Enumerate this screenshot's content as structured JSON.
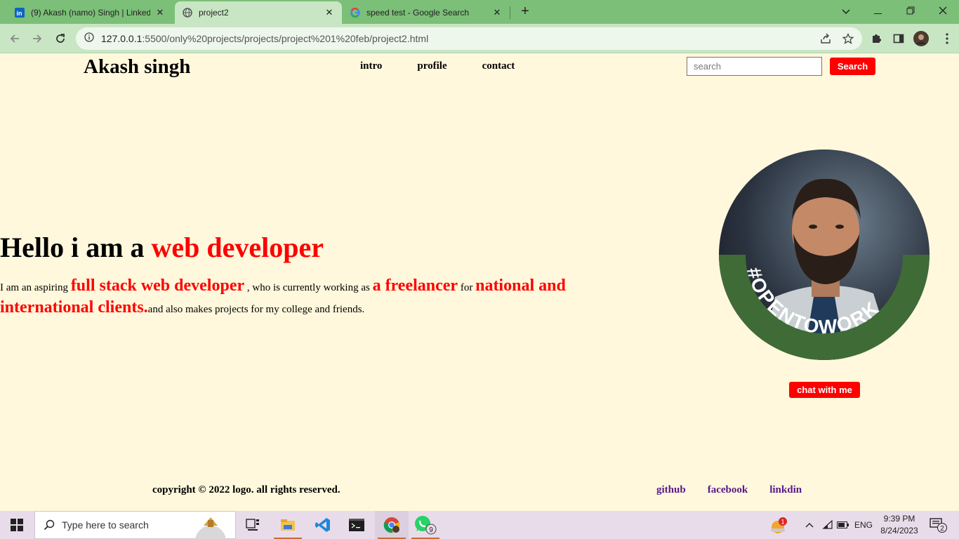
{
  "browser": {
    "tabs": [
      {
        "title": "(9) Akash (namo) Singh | LinkedIn",
        "icon": "linkedin-icon"
      },
      {
        "title": "project2",
        "icon": "globe-icon"
      },
      {
        "title": "speed test - Google Search",
        "icon": "google-icon"
      }
    ],
    "url": {
      "host": "127.0.0.1",
      "path": ":5500/only%20projects/projects/project%201%20feb/project2.html"
    }
  },
  "page": {
    "logo": "Akash singh",
    "nav": [
      "intro",
      "profile",
      "contact"
    ],
    "search": {
      "placeholder": "search",
      "button": "Search"
    },
    "hero": {
      "title_prefix": "Hello i am a",
      "title_highlight": "web developer",
      "text_1": "I am an aspiring",
      "text_2": "full stack web developer",
      "text_3": ", who is currently working as",
      "text_4": "a freelancer",
      "text_5": "for",
      "text_6": "national and international clients.",
      "text_7": "and also makes projects for my college and friends."
    },
    "avatar_badge": "#OPENTOWORK",
    "chat_button": "chat with me",
    "footer": {
      "copyright": "copyright © 2022 logo. all rights reserved.",
      "links": [
        "github",
        "facebook",
        "linkdin"
      ]
    }
  },
  "taskbar": {
    "search_placeholder": "Type here to search",
    "language": "ENG",
    "time": "9:39 PM",
    "date": "8/24/2023",
    "notifications": "2",
    "whatsapp_badge": "9",
    "alert_badge": "1"
  },
  "colors": {
    "accent": "#ff0000",
    "page_bg": "#fff8dc",
    "tabstrip": "#7cbf78",
    "toolbar": "#c9e6c4",
    "link_visited": "#551a8b"
  }
}
